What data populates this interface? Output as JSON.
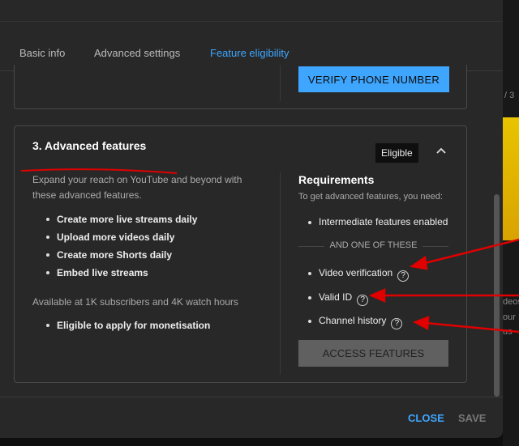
{
  "background": {
    "side_text": [
      "/ 3",
      "deos",
      "our",
      "us"
    ]
  },
  "tabs": [
    {
      "label": "Basic info"
    },
    {
      "label": "Advanced settings"
    },
    {
      "label": "Feature eligibility",
      "active": true
    }
  ],
  "prev_card": {
    "verify_button": "VERIFY PHONE NUMBER"
  },
  "advanced": {
    "title": "3. Advanced features",
    "status_badge": "Eligible",
    "intro": "Expand your reach on YouTube and beyond with these advanced features.",
    "features": [
      "Create more live streams daily",
      "Upload more videos daily",
      "Create more Shorts daily",
      "Embed live streams"
    ],
    "availability": "Available at 1K subscribers and 4K watch hours",
    "availability_items": [
      "Eligible to apply for monetisation"
    ],
    "requirements": {
      "title": "Requirements",
      "subtitle": "To get advanced features, you need:",
      "required": "Intermediate features enabled",
      "separator": "AND ONE OF THESE",
      "options": [
        "Video verification",
        "Valid ID",
        "Channel history"
      ],
      "help_icon": "?",
      "button": "ACCESS FEATURES"
    }
  },
  "footer": {
    "close": "CLOSE",
    "save": "SAVE"
  },
  "colors": {
    "accent": "#3ea6ff",
    "annotation": "#e00000",
    "dialog_bg": "#282828"
  }
}
